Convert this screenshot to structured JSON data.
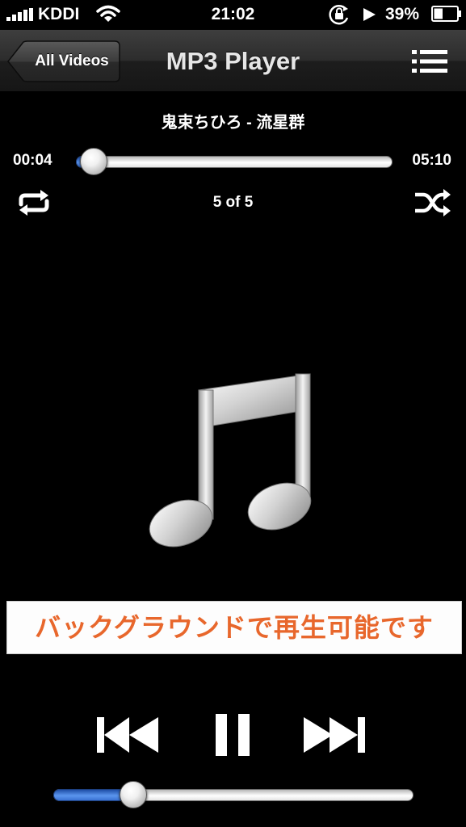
{
  "status_bar": {
    "carrier": "KDDI",
    "time": "21:02",
    "battery_percent": "39%",
    "battery_level": 0.39,
    "icons": [
      "signal-icon",
      "wifi-icon",
      "rotation-lock-icon",
      "play-icon",
      "battery-icon"
    ]
  },
  "nav": {
    "back_label": "All Videos",
    "title": "MP3 Player",
    "menu_icon": "list-icon"
  },
  "player": {
    "track_title": "鬼束ちひろ - 流星群",
    "elapsed": "00:04",
    "duration": "05:10",
    "progress_fraction": 0.013,
    "track_counter": "5 of 5",
    "repeat_icon": "repeat-icon",
    "shuffle_icon": "shuffle-icon",
    "artwork_icon": "music-note-icon",
    "volume_fraction": 0.2
  },
  "banner": {
    "text": "バックグラウンドで再生可能です"
  },
  "controls": {
    "prev_icon": "previous-track-icon",
    "pause_icon": "pause-icon",
    "next_icon": "next-track-icon"
  },
  "colors": {
    "accent_blue": "#3a72d3",
    "banner_text": "#e8672c",
    "background": "#000000"
  }
}
